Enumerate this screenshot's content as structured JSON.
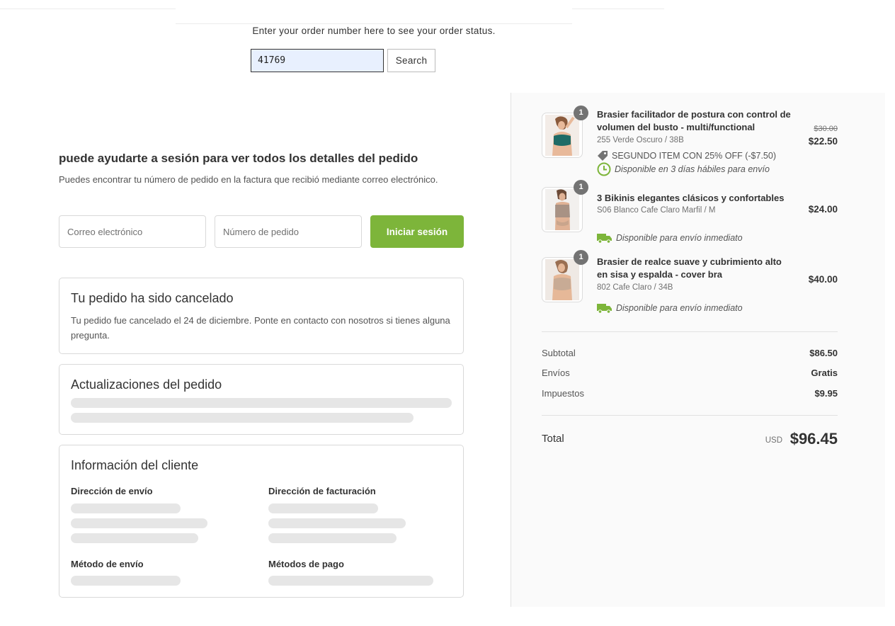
{
  "lookup": {
    "prompt": "Enter your order number here to see your order status.",
    "order_number": "41769",
    "search_label": "Search"
  },
  "login": {
    "title": "puede ayudarte a sesión para ver todos los detalles del pedido",
    "description": "Puedes encontrar tu número de pedido en la factura que recibió mediante correo electrónico.",
    "email_placeholder": "Correo electrónico",
    "order_placeholder": "Número de pedido",
    "button_label": "Iniciar sesión"
  },
  "cancelled": {
    "title": "Tu pedido ha sido cancelado",
    "text": "Tu pedido fue cancelado el 24 de diciembre. Ponte en contacto con nosotros si tienes alguna pregunta."
  },
  "updates": {
    "title": "Actualizaciones del pedido"
  },
  "customer": {
    "title": "Información del cliente",
    "shipping_address": "Dirección de envío",
    "billing_address": "Dirección de facturación",
    "shipping_method": "Método de envío",
    "payment_methods": "Métodos de pago"
  },
  "summary": {
    "items": [
      {
        "qty": "1",
        "name": "Brasier facilitador de postura con control de volumen del busto - multi/functional",
        "variant": "255 Verde Oscuro / 38B",
        "discount": "SEGUNDO ITEM CON 25% OFF (-$7.50)",
        "availability": "Disponible en 3 días hábiles para envío",
        "old_price": "$30.00",
        "price": "$22.50",
        "availability_icon": "clock-icon"
      },
      {
        "qty": "1",
        "name": "3 Bikinis elegantes clásicos y confortables",
        "variant": "S06 Blanco Cafe Claro Marfil / M",
        "availability": "Disponible para envío inmediato",
        "price": "$24.00",
        "availability_icon": "truck-icon"
      },
      {
        "qty": "1",
        "name": "Brasier de realce suave y cubrimiento alto en sisa y espalda - cover bra",
        "variant": "802 Cafe Claro / 34B",
        "availability": "Disponible para envío inmediato",
        "price": "$40.00",
        "availability_icon": "truck-icon"
      }
    ],
    "subtotal_label": "Subtotal",
    "subtotal": "$86.50",
    "shipping_label": "Envíos",
    "shipping": "Gratis",
    "taxes_label": "Impuestos",
    "taxes": "$9.95",
    "total_label": "Total",
    "currency": "USD",
    "total": "$96.45"
  },
  "colors": {
    "accent_green": "#7db53a",
    "sidebar_bg": "#fafafa",
    "skeleton": "#e6e6e6"
  }
}
